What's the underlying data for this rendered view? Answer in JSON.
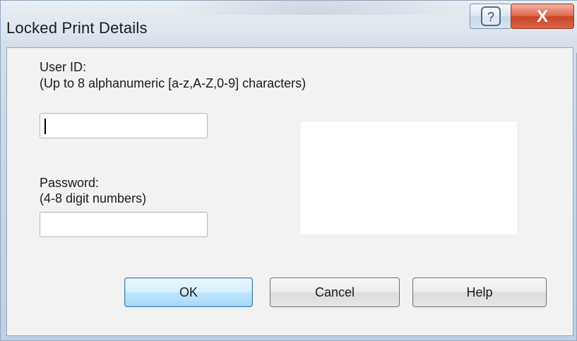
{
  "window": {
    "title": "Locked Print Details"
  },
  "caption": {
    "help_glyph": "?",
    "close_glyph": "X"
  },
  "form": {
    "user_id_label": "User ID:",
    "user_id_hint": "(Up to 8 alphanumeric [a-z,A-Z,0-9] characters)",
    "user_id_value": "",
    "password_label": "Password:",
    "password_hint": "(4-8 digit numbers)",
    "password_value": ""
  },
  "buttons": {
    "ok": "OK",
    "cancel": "Cancel",
    "help": "Help"
  }
}
